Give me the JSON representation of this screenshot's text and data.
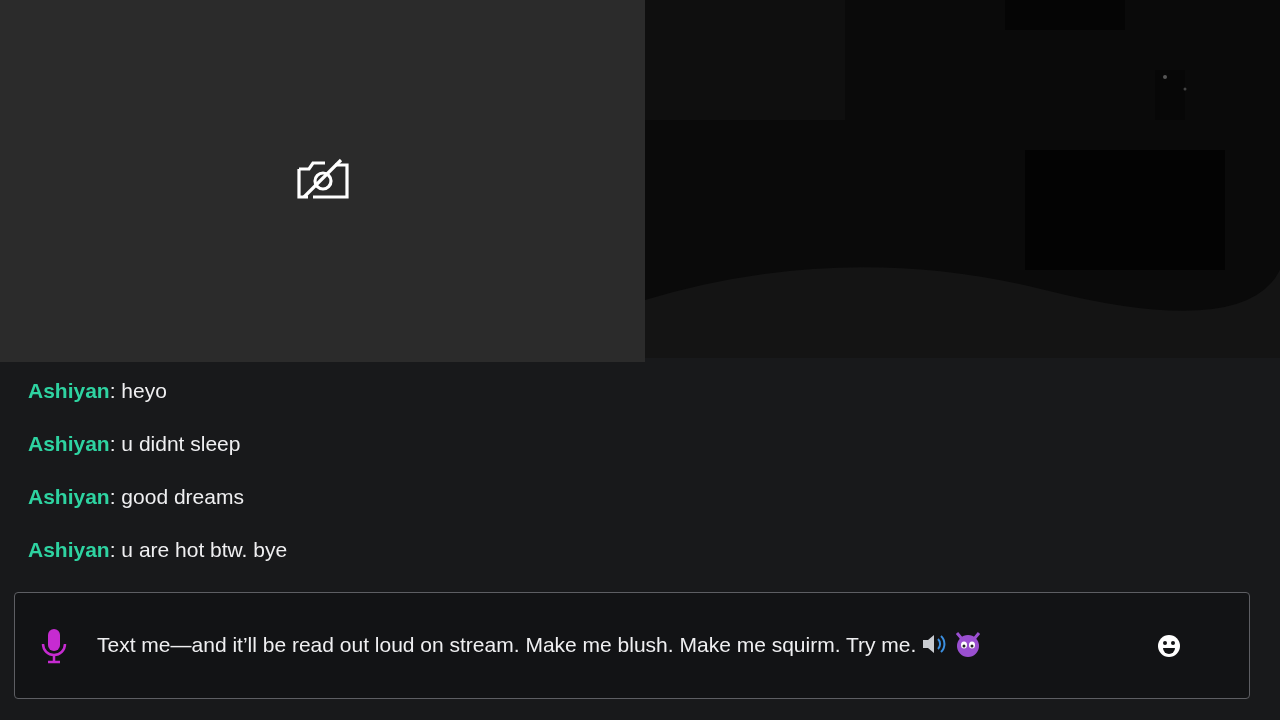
{
  "video_tiles": [
    {
      "kind": "camera_off"
    },
    {
      "kind": "dark_feed"
    }
  ],
  "chat": {
    "messages": [
      {
        "user": "Ashiyan",
        "text": ": heyo",
        "color": "#2ed3a1"
      },
      {
        "user": "Ashiyan",
        "text": ": u didnt sleep",
        "color": "#2ed3a1"
      },
      {
        "user": "Ashiyan",
        "text": ": good dreams",
        "color": "#2ed3a1"
      },
      {
        "user": "Ashiyan",
        "text": ": u are hot btw. bye",
        "color": "#2ed3a1"
      }
    ]
  },
  "composer": {
    "placeholder": "Text me—and it’ll be read out loud on stream. Make me blush. Make me squirm. Try me."
  }
}
